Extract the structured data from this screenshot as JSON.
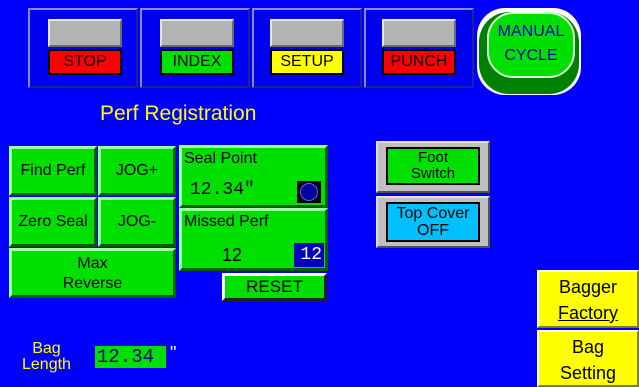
{
  "modes": [
    {
      "label": "STOP",
      "bg": "#ff0000",
      "fg": "#000000"
    },
    {
      "label": "INDEX",
      "bg": "#00e000",
      "fg": "#000000"
    },
    {
      "label": "SETUP",
      "bg": "#ffff00",
      "fg": "#000000"
    },
    {
      "label": "PUNCH",
      "bg": "#ff0000",
      "fg": "#000000"
    }
  ],
  "manual_cycle": {
    "line1": "MANUAL",
    "line2": "CYCLE"
  },
  "section_title": "Perf Registration",
  "buttons": {
    "find_perf": "Find Perf",
    "jog_plus": "JOG+",
    "zero_seal": "Zero Seal",
    "jog_minus": "JOG-",
    "max_reverse_line1": "Max",
    "max_reverse_line2": "Reverse",
    "reset": "RESET"
  },
  "seal_point": {
    "label": "Seal Point",
    "value": "12.34\""
  },
  "missed_perf": {
    "label": "Missed Perf",
    "value": "12",
    "setpoint": "12"
  },
  "foot_switch": {
    "line1": "Foot",
    "line2": "Switch"
  },
  "top_cover": {
    "line1": "Top Cover",
    "line2": "OFF"
  },
  "bagger_factory": {
    "line1": "Bagger",
    "line2": "Factory"
  },
  "bag_setting": {
    "line1": "Bag",
    "line2": "Setting"
  },
  "bag_length": {
    "label_line1": "Bag",
    "label_line2": "Length",
    "value": "12.34",
    "unit": "\""
  },
  "colors": {
    "background": "#0000ff",
    "accent_green": "#00e000",
    "label_yellow": "#ffff00",
    "cyan": "#00c0ff"
  }
}
